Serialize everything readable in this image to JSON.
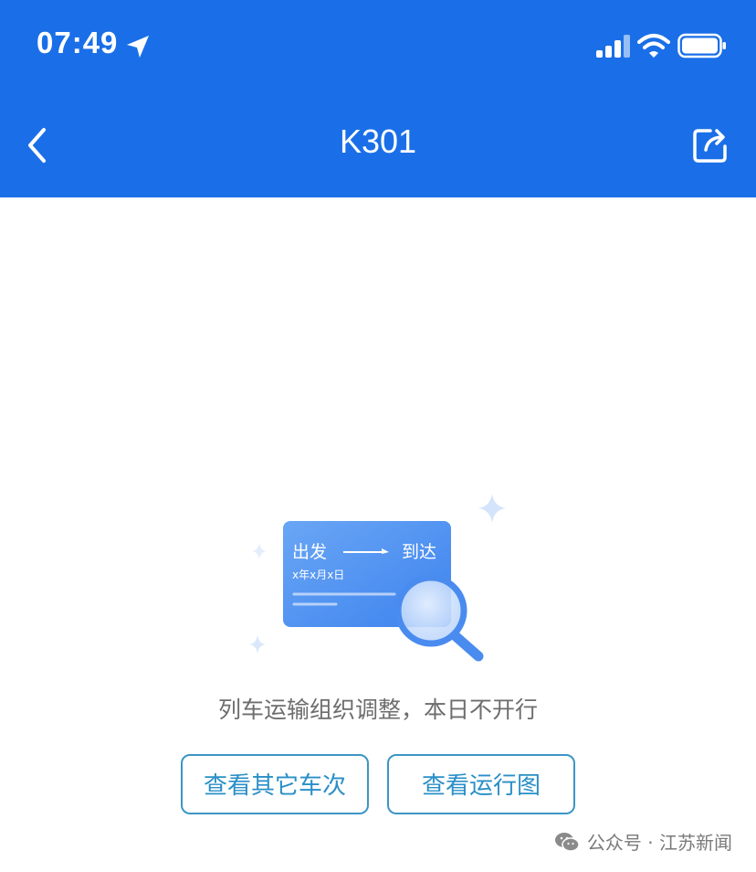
{
  "status_bar": {
    "time": "07:49"
  },
  "header": {
    "title": "K301"
  },
  "illustration": {
    "depart_label": "出发",
    "arrive_label": "到达",
    "date_label": "x年x月x日"
  },
  "empty_state": {
    "message": "列车运输组织调整，本日不开行"
  },
  "buttons": {
    "other_trains": "查看其它车次",
    "run_map": "查看运行图"
  },
  "watermark": {
    "text": "公众号 · 江苏新闻"
  },
  "colors": {
    "header_bg": "#1a6fe8",
    "button_border": "#3c95c6",
    "button_text": "#2a8fc7",
    "message_text": "#6d6d6d"
  }
}
